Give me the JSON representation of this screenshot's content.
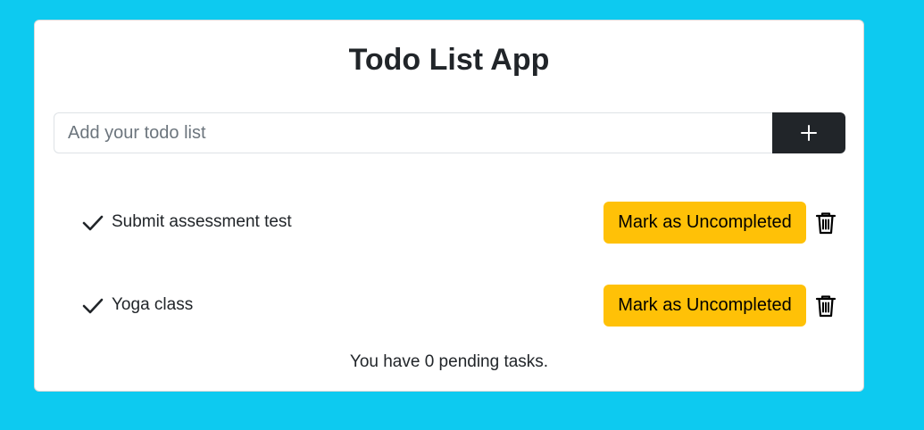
{
  "app": {
    "title": "Todo List App"
  },
  "input": {
    "placeholder": "Add your todo list",
    "value": "",
    "add_icon": "plus-icon"
  },
  "todos": [
    {
      "text": "Submit assessment test",
      "button_label": "Mark as Uncompleted",
      "completed": true
    },
    {
      "text": "Yoga class",
      "button_label": "Mark as Uncompleted",
      "completed": true
    }
  ],
  "footer": {
    "pending_text": "You have 0 pending tasks."
  },
  "colors": {
    "background": "#0dcaf0",
    "card": "#ffffff",
    "add_button": "#212529",
    "mark_button": "#ffc107",
    "text": "#212529"
  }
}
